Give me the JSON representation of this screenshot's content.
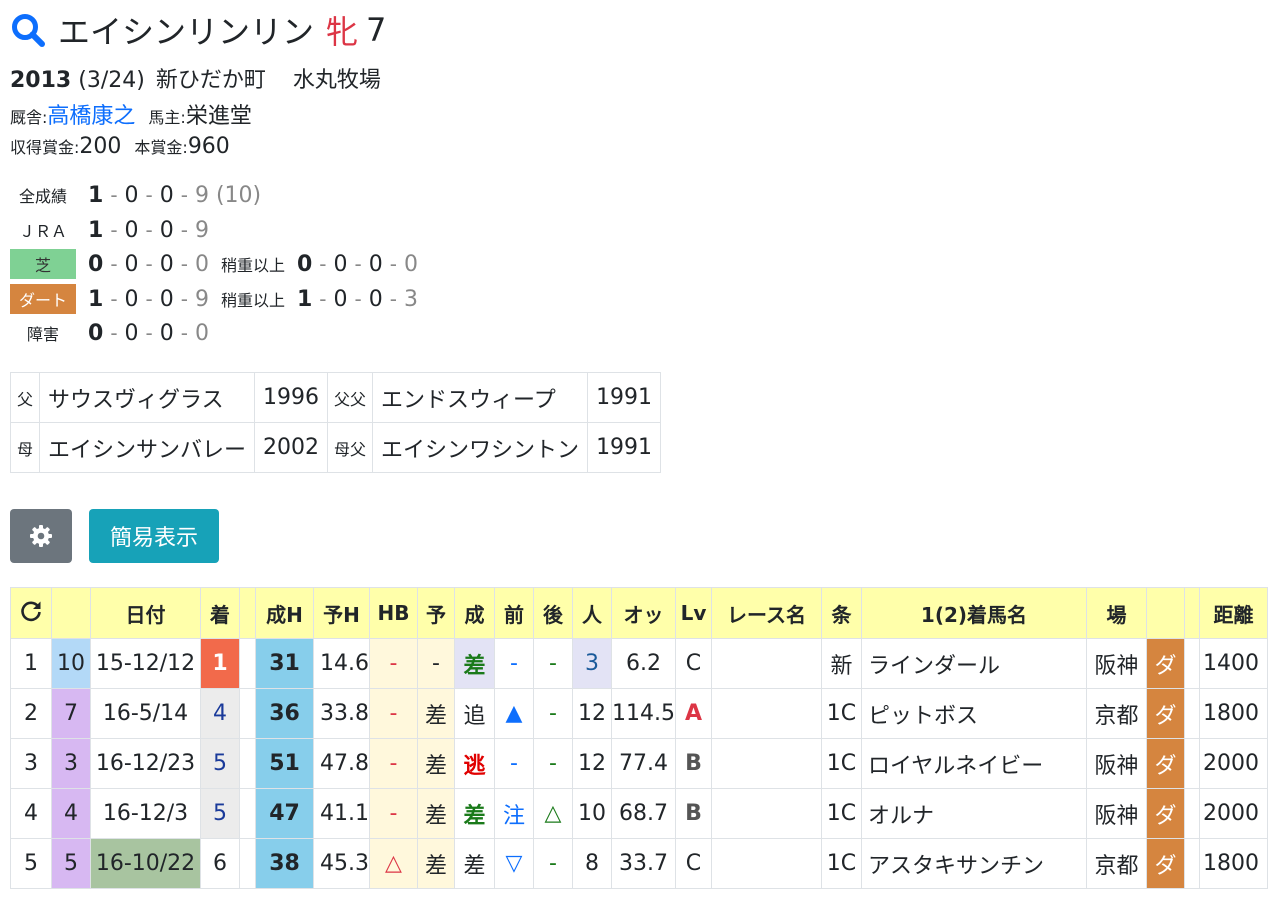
{
  "horse": {
    "name": "エイシンリンリン",
    "sex": "牝",
    "age": "7"
  },
  "profile": {
    "year": "2013",
    "date": "(3/24)",
    "birthplace": "新ひだか町",
    "breeder": "水丸牧場",
    "trainer_label": "厩舎:",
    "trainer": "高橋康之",
    "owner_label": "馬主:",
    "owner": "栄進堂",
    "earned_label": "収得賞金:",
    "earned": "200",
    "main_label": "本賞金:",
    "main": "960"
  },
  "records": [
    {
      "label": "全成績",
      "w": "1",
      "s": "0",
      "t": "0",
      "o": "9 (10)"
    },
    {
      "label": "ＪＲＡ",
      "w": "1",
      "s": "0",
      "t": "0",
      "o": "9"
    },
    {
      "label": "芝",
      "w": "0",
      "s": "0",
      "t": "0",
      "o": "0",
      "heavy_label": "稍重以上",
      "hw": "0",
      "hs": "0",
      "ht": "0",
      "ho": "0"
    },
    {
      "label": "ダート",
      "w": "1",
      "s": "0",
      "t": "0",
      "o": "9",
      "heavy_label": "稍重以上",
      "hw": "1",
      "hs": "0",
      "ht": "0",
      "ho": "3"
    },
    {
      "label": "障害",
      "w": "0",
      "s": "0",
      "t": "0",
      "o": "0"
    }
  ],
  "pedigree": {
    "sire_label": "父",
    "sire": "サウスヴィグラス",
    "sire_year": "1996",
    "bms_sire_label": "父父",
    "sires_sire": "エンドスウィープ",
    "sires_sire_year": "1991",
    "dam_label": "母",
    "dam": "エイシンサンバレー",
    "dam_year": "2002",
    "dams_sire_label": "母父",
    "dams_sire": "エイシンワシントン",
    "dams_sire_year": "1991"
  },
  "buttons": {
    "settings_icon": "gear-icon",
    "simple": "簡易表示"
  },
  "table": {
    "headers": [
      "",
      "",
      "日付",
      "着",
      "",
      "成H",
      "予H",
      "HB",
      "予",
      "成",
      "前",
      "後",
      "人",
      "オッ",
      "Lv",
      "レース名",
      "条",
      "1(2)着馬名",
      "場",
      "",
      "",
      "距離"
    ],
    "rows": [
      [
        "1",
        "10",
        "15-12/12",
        "1",
        "",
        "31",
        "14.6",
        "-",
        "-",
        "差",
        "-",
        "-",
        "3",
        "6.2",
        "C",
        "",
        "新",
        "ラインダール",
        "阪神",
        "ダ",
        "",
        "1400"
      ],
      [
        "2",
        "7",
        "16-5/14",
        "4",
        "",
        "36",
        "33.8",
        "-",
        "差",
        "追",
        "▲",
        "-",
        "12",
        "114.5",
        "A",
        "",
        "1C",
        "ピットボス",
        "京都",
        "ダ",
        "",
        "1800"
      ],
      [
        "3",
        "3",
        "16-12/23",
        "5",
        "",
        "51",
        "47.8",
        "-",
        "差",
        "逃",
        "-",
        "-",
        "12",
        "77.4",
        "B",
        "",
        "1C",
        "ロイヤルネイビー",
        "阪神",
        "ダ",
        "",
        "2000"
      ],
      [
        "4",
        "4",
        "16-12/3",
        "5",
        "",
        "47",
        "41.1",
        "-",
        "差",
        "差",
        "注",
        "△",
        "10",
        "68.7",
        "B",
        "",
        "1C",
        "オルナ",
        "阪神",
        "ダ",
        "",
        "2000"
      ],
      [
        "5",
        "5",
        "16-10/22",
        "6",
        "",
        "38",
        "45.3",
        "△",
        "差",
        "差",
        "▽",
        "-",
        "8",
        "33.7",
        "C",
        "",
        "1C",
        "アスタキサンチン",
        "京都",
        "ダ",
        "",
        "1800"
      ]
    ]
  },
  "colors": {
    "header_bg": "#ffffaa",
    "win_rank": "#f26a4b",
    "fig_h": "#87ceeb",
    "cream": "#fff8dc",
    "frame_blue": "#b3d9f7",
    "frame_purple": "#d7b8f2",
    "dirt": "#d5853f",
    "turf": "#7fd194",
    "date_green": "#a8c4a0",
    "grey_cell": "#ececec"
  }
}
